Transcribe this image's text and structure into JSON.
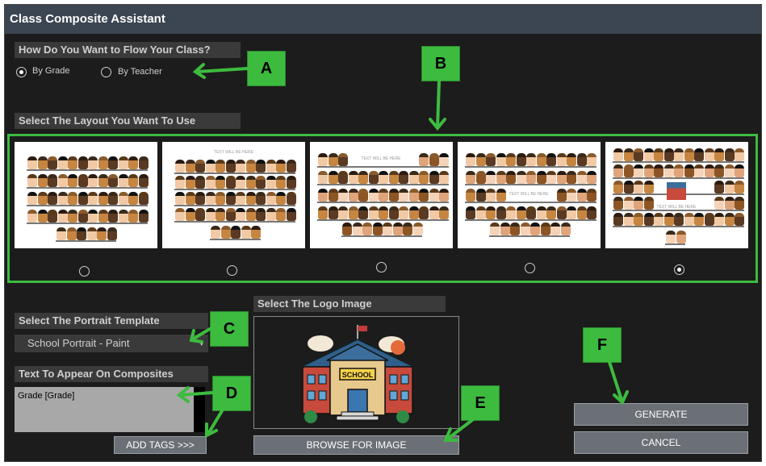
{
  "window": {
    "title": "Class Composite Assistant"
  },
  "flow": {
    "label": "How Do You Want to Flow Your Class?",
    "options": [
      "By Grade",
      "By Teacher"
    ],
    "selected": "By Grade"
  },
  "layout": {
    "label": "Select The Layout You Want To Use",
    "thumbnails": [
      {
        "text": "",
        "selected": false
      },
      {
        "text": "TEXT WILL BE HERE",
        "selected": false
      },
      {
        "text": "TEXT WILL BE HERE",
        "selected": false
      },
      {
        "text": "TEXT WILL BE HERE",
        "selected": false
      },
      {
        "text": "TEXT WILL BE HERE",
        "selected": true
      }
    ]
  },
  "portrait": {
    "label": "Select The Portrait Template",
    "value": "School Portrait - Paint"
  },
  "composite_text": {
    "label": "Text To Appear On Composites",
    "value": "Grade [Grade]",
    "add_tags": "ADD TAGS >>>"
  },
  "logo": {
    "label": "Select The Logo Image",
    "sign": "SCHOOL",
    "browse": "BROWSE FOR IMAGE"
  },
  "actions": {
    "generate": "GENERATE",
    "cancel": "CANCEL"
  },
  "annotations": [
    "A",
    "B",
    "C",
    "D",
    "E",
    "F"
  ],
  "colors": {
    "accent_green": "#3dbb3f",
    "titlebar": "#3c4552",
    "background": "#1c1c1c"
  }
}
